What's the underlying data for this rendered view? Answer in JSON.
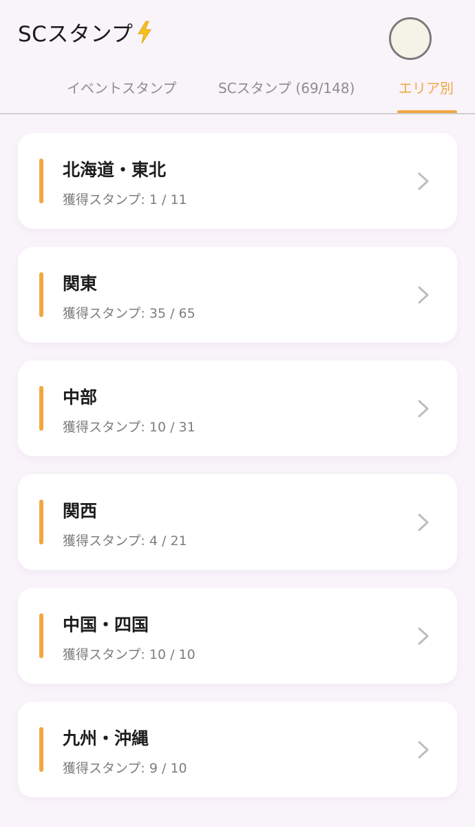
{
  "header": {
    "title": "SCスタンプ",
    "title_icon": "lightning-bolt-icon",
    "avatar_icon": "avatar"
  },
  "tabs": [
    {
      "label": "イベントスタンプ",
      "active": false
    },
    {
      "label": "SCスタンプ (69/148)",
      "active": false
    },
    {
      "label": "エリア別",
      "active": true
    }
  ],
  "colors": {
    "accent": "#f0a73f",
    "background": "#f9f3fa",
    "card": "#ffffff"
  },
  "areas": [
    {
      "name": "北海道・東北",
      "progress_label": "獲得スタンプ:",
      "progress": "1 / 11"
    },
    {
      "name": "関東",
      "progress_label": "獲得スタンプ:",
      "progress": "35 / 65"
    },
    {
      "name": "中部",
      "progress_label": "獲得スタンプ:",
      "progress": "10 / 31"
    },
    {
      "name": "関西",
      "progress_label": "獲得スタンプ:",
      "progress": "4 / 21"
    },
    {
      "name": "中国・四国",
      "progress_label": "獲得スタンプ:",
      "progress": "10 / 10"
    },
    {
      "name": "九州・沖縄",
      "progress_label": "獲得スタンプ:",
      "progress": "9 / 10"
    }
  ]
}
